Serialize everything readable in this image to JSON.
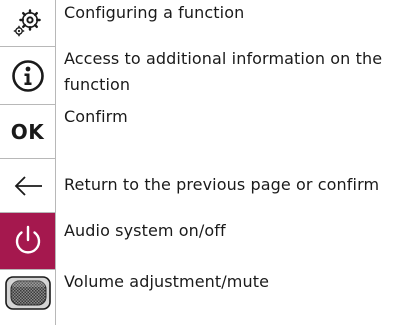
{
  "legend": {
    "rows": [
      {
        "icon": "settings-gears-icon",
        "description": "Configuring a function"
      },
      {
        "icon": "info-icon",
        "description": "Access to additional information on the function"
      },
      {
        "icon": "ok-icon",
        "icon_text": "OK",
        "description": "Confirm"
      },
      {
        "icon": "back-arrow-icon",
        "description": "Return to the previous page or confirm"
      },
      {
        "icon": "power-icon",
        "description": "Audio system on/off"
      },
      {
        "icon": "volume-knob-icon",
        "description": "Volume adjustment/mute"
      }
    ],
    "colors": {
      "power_background": "#a5184e",
      "divider": "#b8b8b8",
      "text": "#1a1a1a"
    }
  }
}
